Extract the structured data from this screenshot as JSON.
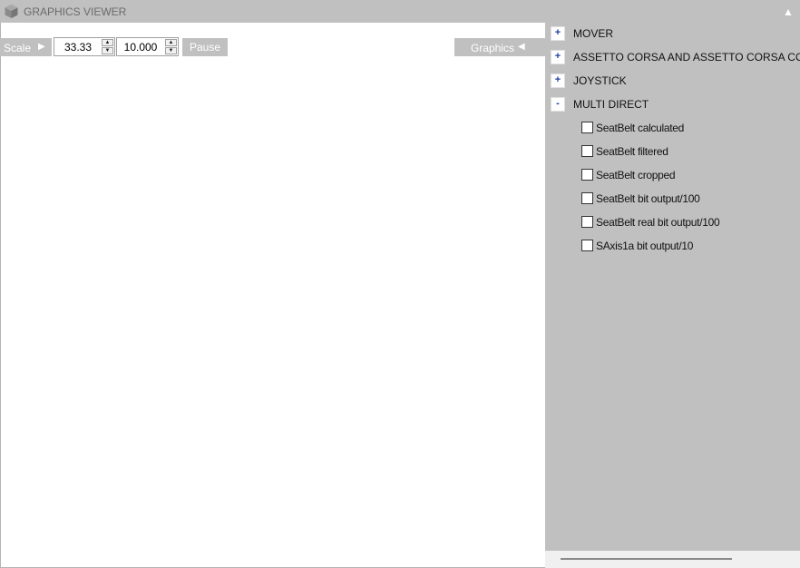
{
  "window": {
    "title": "GRAPHICS VIEWER",
    "icon": "cube-logo-icon",
    "collapse_icon": "▲"
  },
  "toolbar": {
    "scale_label": "Scale",
    "scale_arrow": "▶",
    "scale_value": "33.33",
    "second_value": "10.000",
    "pause_label": "Pause",
    "graphics_label": "Graphics",
    "graphics_arrow": "◀"
  },
  "tree": {
    "groups": [
      {
        "toggle": "+",
        "label": "MOVER"
      },
      {
        "toggle": "+",
        "label": "ASSETTO CORSA AND ASSETTO CORSA COMP"
      },
      {
        "toggle": "+",
        "label": "JOYSTICK"
      },
      {
        "toggle": "-",
        "label": "MULTI DIRECT"
      }
    ],
    "items": [
      {
        "label": "SeatBelt calculated",
        "checked": false
      },
      {
        "label": "SeatBelt filtered",
        "checked": false
      },
      {
        "label": "SeatBelt cropped",
        "checked": false
      },
      {
        "label": "SeatBelt bit output/100",
        "checked": false
      },
      {
        "label": "SeatBelt real bit output/100",
        "checked": false
      },
      {
        "label": "SAxis1a bit output/10",
        "checked": false
      }
    ]
  },
  "colors": {
    "panel_gray": "#c0c0c0",
    "toggle_blue": "#1e3ea0"
  }
}
